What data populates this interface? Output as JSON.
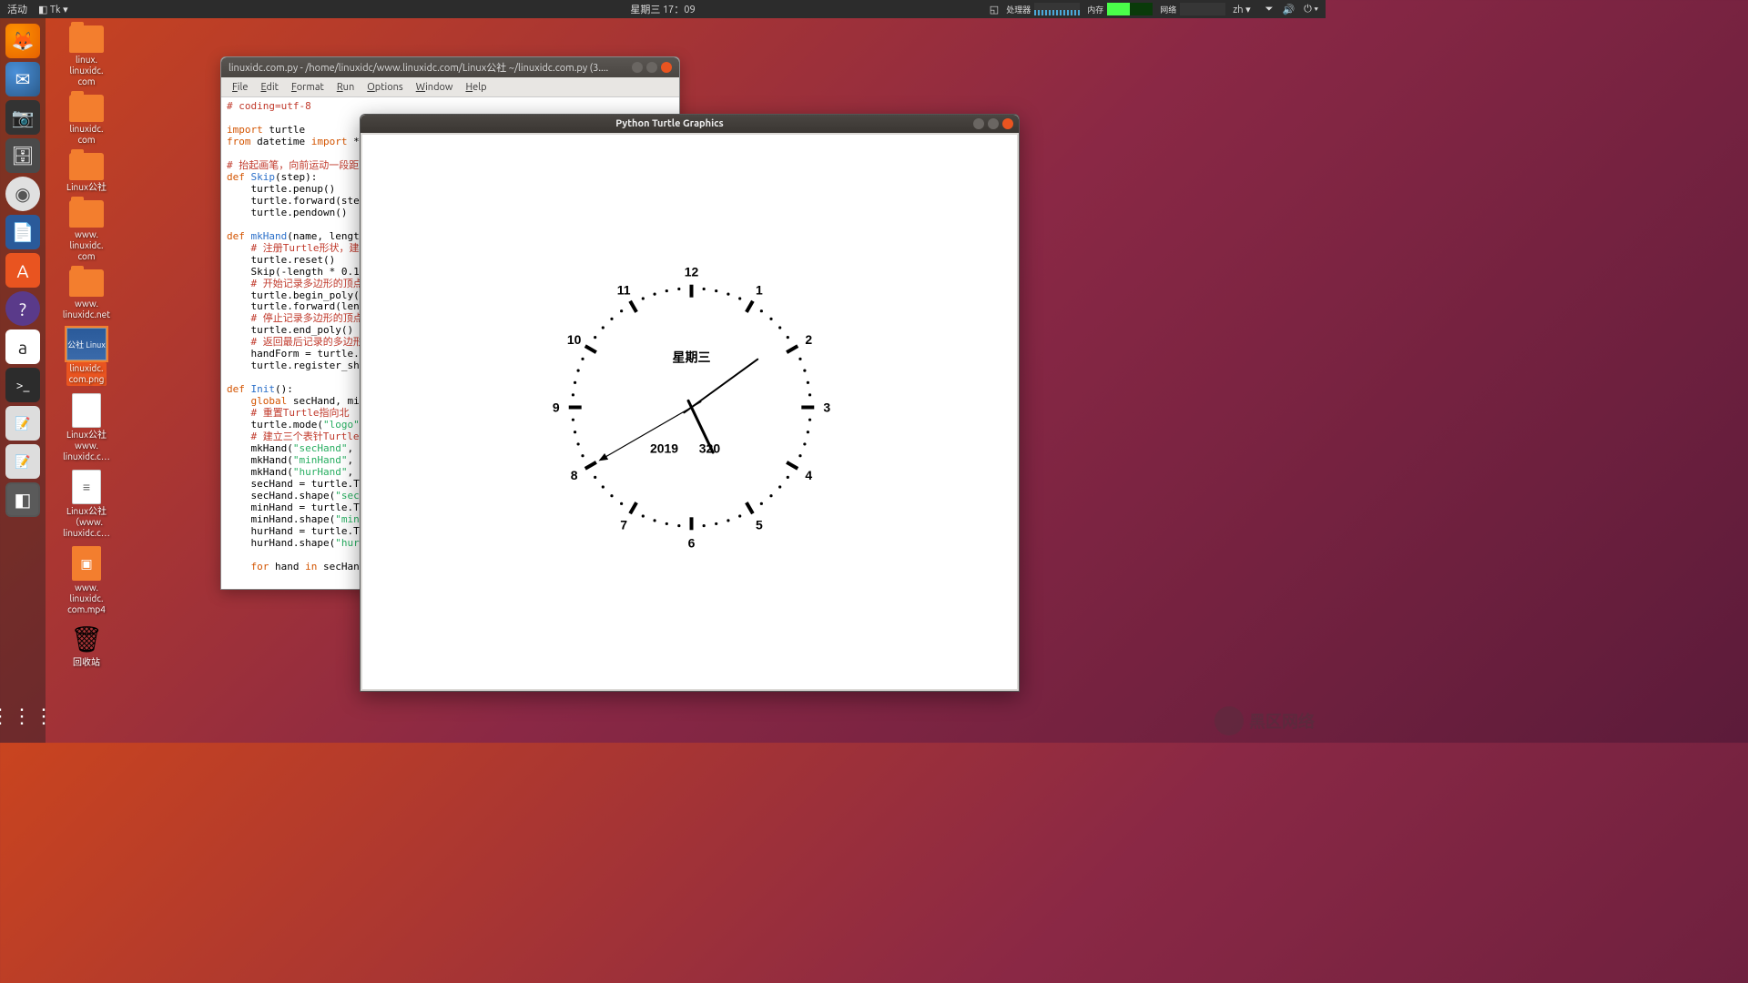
{
  "topbar": {
    "activities": "活动",
    "app_menu": "Tk ▾",
    "clock": "星期三 17：09",
    "cpu_label": "处理器",
    "mem_label": "内存",
    "net_label": "网络",
    "lang": "zh ▾"
  },
  "launcher_icons": [
    "firefox",
    "thunderbird",
    "camera",
    "files",
    "cd",
    "docs",
    "software",
    "help",
    "amazon",
    "terminal",
    "gedit",
    "gedit",
    "idle"
  ],
  "desktop": [
    {
      "type": "folder",
      "label": "linux.\nlinuxidc.\ncom"
    },
    {
      "type": "folder",
      "label": "linuxidc.\ncom"
    },
    {
      "type": "folder",
      "label": "Linux公社"
    },
    {
      "type": "folder",
      "label": "www.\nlinuxidc.\ncom"
    },
    {
      "type": "folder",
      "label": "www.\nlinuxidc.net"
    },
    {
      "type": "image",
      "label": "linuxidc.\ncom.png",
      "selected": true,
      "badge": "公社 Linux"
    },
    {
      "type": "file",
      "label": "Linux公社\nwww.\nlinuxidc.c…",
      "glyph": "</>"
    },
    {
      "type": "file",
      "label": "Linux公社\n（www.\nlinuxidc.c…",
      "glyph": "≡"
    },
    {
      "type": "video",
      "label": "www.\nlinuxidc.\ncom.mp4"
    },
    {
      "type": "trash",
      "label": "回收站"
    }
  ],
  "idle": {
    "title": "linuxidc.com.py - /home/linuxidc/www.linuxidc.com/Linux公社 ~/linuxidc.com.py (3....",
    "menu": [
      "File",
      "Edit",
      "Format",
      "Run",
      "Options",
      "Window",
      "Help"
    ]
  },
  "turtle": {
    "title": "Python Turtle Graphics",
    "weekday": "星期三",
    "date_left": "2019",
    "date_right": "320",
    "hour": 17,
    "minute": 9,
    "second": 40
  },
  "watermark": "黑区网络"
}
